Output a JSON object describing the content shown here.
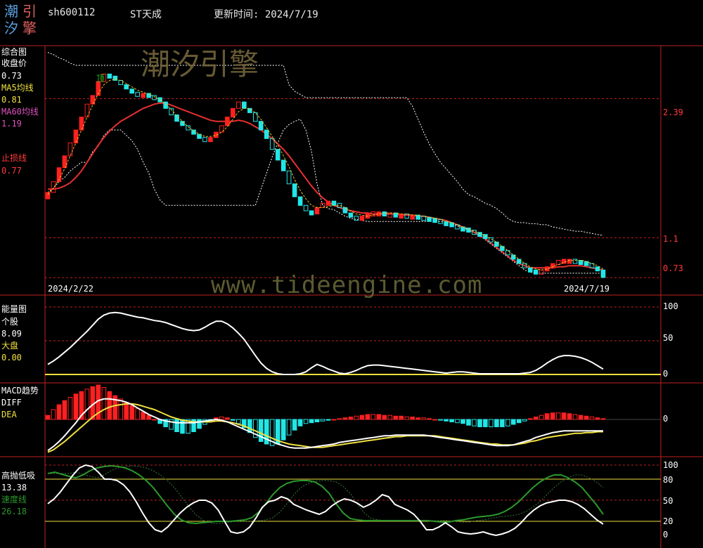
{
  "header": {
    "logo_chars": [
      "潮",
      "引",
      "汐",
      "擎"
    ],
    "code": "sh600112",
    "name": "ST天成",
    "update_label": "更新时间: 2024/7/19"
  },
  "watermarks": {
    "brand": "潮汐引擎",
    "url": "www.tideengine.com"
  },
  "colors": {
    "up": "#ff2020",
    "down": "#22e6e6",
    "ma5": "#ffffff",
    "ma60": "#e83030",
    "grid": "#c02020",
    "energy": "#ffffff",
    "dea": "#f0e040",
    "speed": "#2a9a2a",
    "yellow": "#f0e040"
  },
  "panels": {
    "main": {
      "title": "综合图",
      "close_label": "收盘价",
      "close_value": "0.73",
      "ma5_label": "MA5均线",
      "ma5_value": "0.81",
      "ma60_label": "MA60均线",
      "ma60_value": "1.19",
      "stop_label": "止损线",
      "stop_value": "0.77",
      "top_marker": "顶",
      "start_date": "2024/2/22",
      "end_date": "2024/7/19",
      "axis_labels": [
        "2.39",
        "1.1",
        "0.73"
      ]
    },
    "energy": {
      "title": "能量图",
      "stock_label": "个股",
      "stock_value": "8.09",
      "market_label": "大盘",
      "market_value": "0.00",
      "axis_labels": [
        "100",
        "50",
        "0"
      ]
    },
    "macd": {
      "title": "MACD趋势",
      "diff_label": "DIFF",
      "dea_label": "DEA",
      "axis_labels": [
        "0"
      ]
    },
    "gaopao": {
      "title": "高抛低吸",
      "value": "13.38",
      "speed_label": "速度线",
      "speed_value": "26.18",
      "axis_labels": [
        "100",
        "80",
        "50",
        "20",
        "0"
      ]
    }
  },
  "chart_data": [
    {
      "type": "candlestick",
      "title": "综合图",
      "x_start": "2024/2/22",
      "x_end": "2024/7/19",
      "n_bars": 100,
      "close": [
        1.52,
        1.62,
        1.75,
        1.86,
        1.98,
        2.1,
        2.22,
        2.34,
        2.42,
        2.55,
        2.62,
        2.6,
        2.56,
        2.52,
        2.48,
        2.45,
        2.44,
        2.44,
        2.42,
        2.4,
        2.36,
        2.3,
        2.24,
        2.18,
        2.14,
        2.1,
        2.06,
        2.03,
        2.0,
        2.03,
        2.08,
        2.14,
        2.22,
        2.3,
        2.36,
        2.3,
        2.26,
        2.18,
        2.1,
        2.02,
        1.92,
        1.82,
        1.72,
        1.6,
        1.48,
        1.4,
        1.35,
        1.32,
        1.38,
        1.42,
        1.44,
        1.42,
        1.38,
        1.33,
        1.3,
        1.28,
        1.3,
        1.32,
        1.34,
        1.34,
        1.33,
        1.33,
        1.32,
        1.32,
        1.31,
        1.31,
        1.3,
        1.29,
        1.28,
        1.27,
        1.25,
        1.24,
        1.22,
        1.2,
        1.19,
        1.17,
        1.15,
        1.13,
        1.1,
        1.06,
        1.02,
        0.98,
        0.94,
        0.9,
        0.86,
        0.82,
        0.8,
        0.79,
        0.8,
        0.83,
        0.86,
        0.89,
        0.9,
        0.9,
        0.89,
        0.88,
        0.86,
        0.83,
        0.8,
        0.73
      ],
      "ma5": [
        1.5,
        1.56,
        1.64,
        1.74,
        1.86,
        1.98,
        2.1,
        2.22,
        2.33,
        2.44,
        2.52,
        2.56,
        2.57,
        2.56,
        2.53,
        2.5,
        2.47,
        2.45,
        2.43,
        2.41,
        2.38,
        2.34,
        2.29,
        2.23,
        2.18,
        2.13,
        2.09,
        2.06,
        2.04,
        2.04,
        2.05,
        2.08,
        2.13,
        2.2,
        2.27,
        2.3,
        2.3,
        2.26,
        2.2,
        2.12,
        2.04,
        1.96,
        1.86,
        1.76,
        1.64,
        1.54,
        1.46,
        1.4,
        1.38,
        1.38,
        1.39,
        1.4,
        1.4,
        1.38,
        1.35,
        1.32,
        1.31,
        1.3,
        1.31,
        1.32,
        1.33,
        1.33,
        1.33,
        1.32,
        1.32,
        1.31,
        1.31,
        1.3,
        1.29,
        1.28,
        1.27,
        1.25,
        1.24,
        1.22,
        1.2,
        1.18,
        1.16,
        1.14,
        1.12,
        1.09,
        1.06,
        1.02,
        0.98,
        0.94,
        0.9,
        0.86,
        0.83,
        0.81,
        0.8,
        0.81,
        0.83,
        0.85,
        0.87,
        0.89,
        0.89,
        0.89,
        0.88,
        0.86,
        0.84,
        0.81
      ],
      "ma60": [
        1.55,
        1.55,
        1.56,
        1.58,
        1.61,
        1.66,
        1.72,
        1.8,
        1.88,
        1.96,
        2.03,
        2.09,
        2.14,
        2.18,
        2.21,
        2.24,
        2.27,
        2.3,
        2.32,
        2.34,
        2.35,
        2.35,
        2.33,
        2.31,
        2.29,
        2.27,
        2.25,
        2.23,
        2.21,
        2.19,
        2.18,
        2.18,
        2.18,
        2.18,
        2.19,
        2.18,
        2.16,
        2.13,
        2.1,
        2.06,
        2.02,
        1.97,
        1.92,
        1.86,
        1.79,
        1.72,
        1.65,
        1.58,
        1.52,
        1.47,
        1.43,
        1.4,
        1.38,
        1.36,
        1.35,
        1.34,
        1.33,
        1.33,
        1.32,
        1.32,
        1.32,
        1.32,
        1.32,
        1.31,
        1.31,
        1.31,
        1.3,
        1.3,
        1.29,
        1.28,
        1.27,
        1.26,
        1.24,
        1.22,
        1.2,
        1.18,
        1.15,
        1.12,
        1.09,
        1.05,
        1.01,
        0.97,
        0.93,
        0.89,
        0.86,
        0.84,
        0.82,
        0.82,
        0.82,
        0.82,
        0.82,
        0.83,
        0.83,
        0.84,
        0.84,
        0.84,
        0.83,
        0.82,
        0.81,
        0.8
      ],
      "upper_band": [
        2.82,
        2.8,
        2.77,
        2.75,
        2.72,
        2.7,
        2.7,
        2.7,
        2.7,
        2.7,
        2.7,
        2.7,
        2.7,
        2.7,
        2.7,
        2.7,
        2.7,
        2.7,
        2.7,
        2.7,
        2.7,
        2.7,
        2.7,
        2.7,
        2.7,
        2.7,
        2.7,
        2.7,
        2.7,
        2.7,
        2.7,
        2.7,
        2.7,
        2.7,
        2.7,
        2.7,
        2.7,
        2.7,
        2.7,
        2.7,
        2.7,
        2.7,
        2.7,
        2.52,
        2.46,
        2.43,
        2.4,
        2.4,
        2.4,
        2.4,
        2.4,
        2.4,
        2.4,
        2.4,
        2.4,
        2.4,
        2.4,
        2.4,
        2.4,
        2.4,
        2.4,
        2.4,
        2.4,
        2.4,
        2.4,
        2.32,
        2.2,
        2.08,
        1.97,
        1.88,
        1.8,
        1.74,
        1.68,
        1.62,
        1.55,
        1.5,
        1.48,
        1.45,
        1.42,
        1.4,
        1.37,
        1.33,
        1.28,
        1.25,
        1.24,
        1.24,
        1.23,
        1.23,
        1.22,
        1.22,
        1.2,
        1.19,
        1.18,
        1.17,
        1.16,
        1.16,
        1.15,
        1.14,
        1.13,
        1.12
      ],
      "lower_band": [
        1.52,
        1.56,
        1.62,
        1.66,
        1.72,
        1.76,
        1.8,
        1.8,
        1.9,
        1.95,
        2.05,
        2.1,
        2.1,
        2.1,
        2.05,
        2.0,
        1.92,
        1.8,
        1.7,
        1.55,
        1.45,
        1.4,
        1.4,
        1.4,
        1.4,
        1.4,
        1.4,
        1.4,
        1.4,
        1.4,
        1.4,
        1.4,
        1.4,
        1.4,
        1.4,
        1.4,
        1.4,
        1.4,
        1.55,
        1.7,
        1.85,
        1.98,
        2.1,
        2.15,
        2.18,
        2.2,
        2.1,
        1.9,
        1.6,
        1.4,
        1.37,
        1.36,
        1.33,
        1.3,
        1.28,
        1.27,
        1.26,
        1.25,
        1.25,
        1.25,
        1.25,
        1.25,
        1.25,
        1.25,
        1.25,
        1.25,
        1.25,
        1.25,
        1.25,
        1.25,
        1.25,
        1.24,
        1.23,
        1.21,
        1.19,
        1.17,
        1.15,
        1.12,
        1.08,
        1.04,
        1.0,
        0.96,
        0.92,
        0.88,
        0.84,
        0.8,
        0.78,
        0.77,
        0.77,
        0.77,
        0.77,
        0.77,
        0.77,
        0.77,
        0.77,
        0.77,
        0.77,
        0.77,
        0.77,
        0.77
      ],
      "ylim": [
        0.6,
        2.85
      ]
    },
    {
      "type": "line",
      "title": "能量图",
      "series_names": [
        "个股",
        "大盘"
      ],
      "ylim": [
        0,
        100
      ],
      "stock": [
        15,
        20,
        26,
        33,
        40,
        48,
        56,
        64,
        73,
        82,
        88,
        91,
        92,
        91,
        89,
        87,
        85,
        84,
        82,
        80,
        79,
        77,
        74,
        71,
        68,
        66,
        65,
        66,
        70,
        75,
        79,
        79,
        75,
        69,
        61,
        52,
        40,
        28,
        17,
        9,
        4,
        1,
        0,
        0,
        0,
        1,
        4,
        10,
        15,
        12,
        8,
        5,
        2,
        1,
        3,
        6,
        10,
        13,
        14,
        14,
        13,
        12,
        11,
        10,
        9,
        8,
        7,
        6,
        5,
        4,
        3,
        2,
        3,
        4,
        4,
        3,
        2,
        1,
        1,
        1,
        1,
        1,
        1,
        1,
        1,
        2,
        3,
        6,
        11,
        17,
        22,
        26,
        28,
        28,
        27,
        25,
        22,
        18,
        13,
        8
      ],
      "market": 0
    },
    {
      "type": "bar+line",
      "title": "MACD趋势",
      "series_names": [
        "DIFF",
        "DEA"
      ],
      "ylim": [
        -0.42,
        0.42
      ],
      "macd_bars": [
        0.05,
        0.12,
        0.18,
        0.23,
        0.27,
        0.31,
        0.34,
        0.37,
        0.4,
        0.42,
        0.39,
        0.34,
        0.29,
        0.25,
        0.21,
        0.17,
        0.13,
        0.09,
        0.05,
        0.0,
        -0.05,
        -0.09,
        -0.12,
        -0.15,
        -0.17,
        -0.17,
        -0.15,
        -0.11,
        -0.06,
        -0.01,
        0.02,
        0.03,
        0.02,
        -0.01,
        -0.05,
        -0.1,
        -0.16,
        -0.22,
        -0.27,
        -0.3,
        -0.32,
        -0.3,
        -0.25,
        -0.19,
        -0.13,
        -0.08,
        -0.05,
        -0.04,
        -0.03,
        -0.02,
        -0.01,
        0.0,
        0.01,
        0.02,
        0.03,
        0.04,
        0.05,
        0.06,
        0.06,
        0.06,
        0.05,
        0.05,
        0.04,
        0.04,
        0.03,
        0.03,
        0.02,
        0.02,
        0.01,
        0.0,
        -0.01,
        -0.02,
        -0.03,
        -0.04,
        -0.05,
        -0.07,
        -0.08,
        -0.09,
        -0.09,
        -0.09,
        -0.09,
        -0.09,
        -0.08,
        -0.06,
        -0.04,
        -0.02,
        0.01,
        0.03,
        0.05,
        0.07,
        0.08,
        0.08,
        0.08,
        0.07,
        0.06,
        0.05,
        0.04,
        0.03,
        0.02,
        0.01
      ],
      "diff": [
        -0.38,
        -0.33,
        -0.27,
        -0.2,
        -0.12,
        -0.04,
        0.05,
        0.12,
        0.18,
        0.23,
        0.25,
        0.25,
        0.24,
        0.23,
        0.21,
        0.18,
        0.14,
        0.1,
        0.06,
        0.03,
        0.0,
        -0.02,
        -0.03,
        -0.04,
        -0.04,
        -0.04,
        -0.04,
        -0.03,
        -0.02,
        -0.01,
        0.0,
        -0.01,
        -0.03,
        -0.06,
        -0.09,
        -0.12,
        -0.15,
        -0.18,
        -0.21,
        -0.24,
        -0.27,
        -0.3,
        -0.32,
        -0.34,
        -0.35,
        -0.35,
        -0.35,
        -0.34,
        -0.33,
        -0.32,
        -0.31,
        -0.3,
        -0.28,
        -0.27,
        -0.26,
        -0.25,
        -0.24,
        -0.23,
        -0.22,
        -0.21,
        -0.2,
        -0.2,
        -0.19,
        -0.19,
        -0.19,
        -0.19,
        -0.19,
        -0.19,
        -0.2,
        -0.21,
        -0.22,
        -0.23,
        -0.24,
        -0.25,
        -0.26,
        -0.27,
        -0.28,
        -0.29,
        -0.3,
        -0.31,
        -0.32,
        -0.32,
        -0.32,
        -0.31,
        -0.29,
        -0.27,
        -0.25,
        -0.22,
        -0.2,
        -0.18,
        -0.16,
        -0.15,
        -0.14,
        -0.14,
        -0.14,
        -0.14,
        -0.14,
        -0.14,
        -0.14,
        -0.14
      ],
      "dea": [
        -0.4,
        -0.37,
        -0.32,
        -0.27,
        -0.21,
        -0.15,
        -0.09,
        -0.03,
        0.03,
        0.08,
        0.12,
        0.15,
        0.17,
        0.18,
        0.19,
        0.19,
        0.18,
        0.16,
        0.14,
        0.12,
        0.09,
        0.06,
        0.03,
        0.01,
        -0.01,
        -0.02,
        -0.03,
        -0.03,
        -0.03,
        -0.03,
        -0.02,
        -0.02,
        -0.03,
        -0.04,
        -0.06,
        -0.08,
        -0.11,
        -0.14,
        -0.17,
        -0.2,
        -0.23,
        -0.26,
        -0.28,
        -0.3,
        -0.31,
        -0.32,
        -0.33,
        -0.34,
        -0.34,
        -0.34,
        -0.33,
        -0.32,
        -0.31,
        -0.3,
        -0.29,
        -0.28,
        -0.27,
        -0.26,
        -0.25,
        -0.24,
        -0.23,
        -0.22,
        -0.21,
        -0.21,
        -0.2,
        -0.2,
        -0.2,
        -0.2,
        -0.2,
        -0.2,
        -0.21,
        -0.22,
        -0.23,
        -0.24,
        -0.25,
        -0.26,
        -0.27,
        -0.28,
        -0.29,
        -0.3,
        -0.3,
        -0.31,
        -0.31,
        -0.31,
        -0.3,
        -0.29,
        -0.27,
        -0.26,
        -0.24,
        -0.22,
        -0.21,
        -0.2,
        -0.19,
        -0.18,
        -0.17,
        -0.17,
        -0.16,
        -0.16,
        -0.15,
        -0.15
      ]
    },
    {
      "type": "line",
      "title": "高抛低吸",
      "series_names": [
        "高抛低吸",
        "速度线"
      ],
      "ylim": [
        0,
        100
      ],
      "reference_lines": [
        80,
        50,
        20
      ],
      "value": [
        45,
        52,
        62,
        74,
        86,
        96,
        100,
        98,
        90,
        80,
        80,
        78,
        72,
        62,
        48,
        32,
        18,
        8,
        5,
        12,
        22,
        32,
        40,
        46,
        50,
        50,
        46,
        36,
        20,
        5,
        3,
        5,
        12,
        25,
        40,
        48,
        50,
        55,
        52,
        44,
        40,
        36,
        33,
        30,
        34,
        42,
        48,
        52,
        50,
        46,
        40,
        44,
        50,
        58,
        55,
        44,
        40,
        36,
        30,
        20,
        8,
        8,
        12,
        18,
        12,
        5,
        3,
        2,
        3,
        5,
        2,
        0,
        2,
        5,
        10,
        18,
        28,
        36,
        42,
        46,
        48,
        50,
        50,
        48,
        44,
        38,
        30,
        22,
        16
      ],
      "speed": [
        88,
        90,
        87,
        84,
        82,
        86,
        92,
        96,
        98,
        99,
        98,
        96,
        92,
        86,
        78,
        68,
        55,
        42,
        30,
        22,
        18,
        17,
        18,
        19,
        20,
        20,
        20,
        21,
        22,
        25,
        33,
        45,
        58,
        68,
        74,
        77,
        78,
        78,
        76,
        70,
        60,
        45,
        32,
        24,
        22,
        21,
        21,
        21,
        21,
        21,
        21,
        21,
        21,
        21,
        21,
        20,
        19,
        19,
        21,
        22,
        24,
        26,
        27,
        28,
        30,
        34,
        40,
        48,
        58,
        68,
        76,
        82,
        86,
        86,
        82,
        76,
        68,
        56,
        44,
        30
      ]
    }
  ]
}
